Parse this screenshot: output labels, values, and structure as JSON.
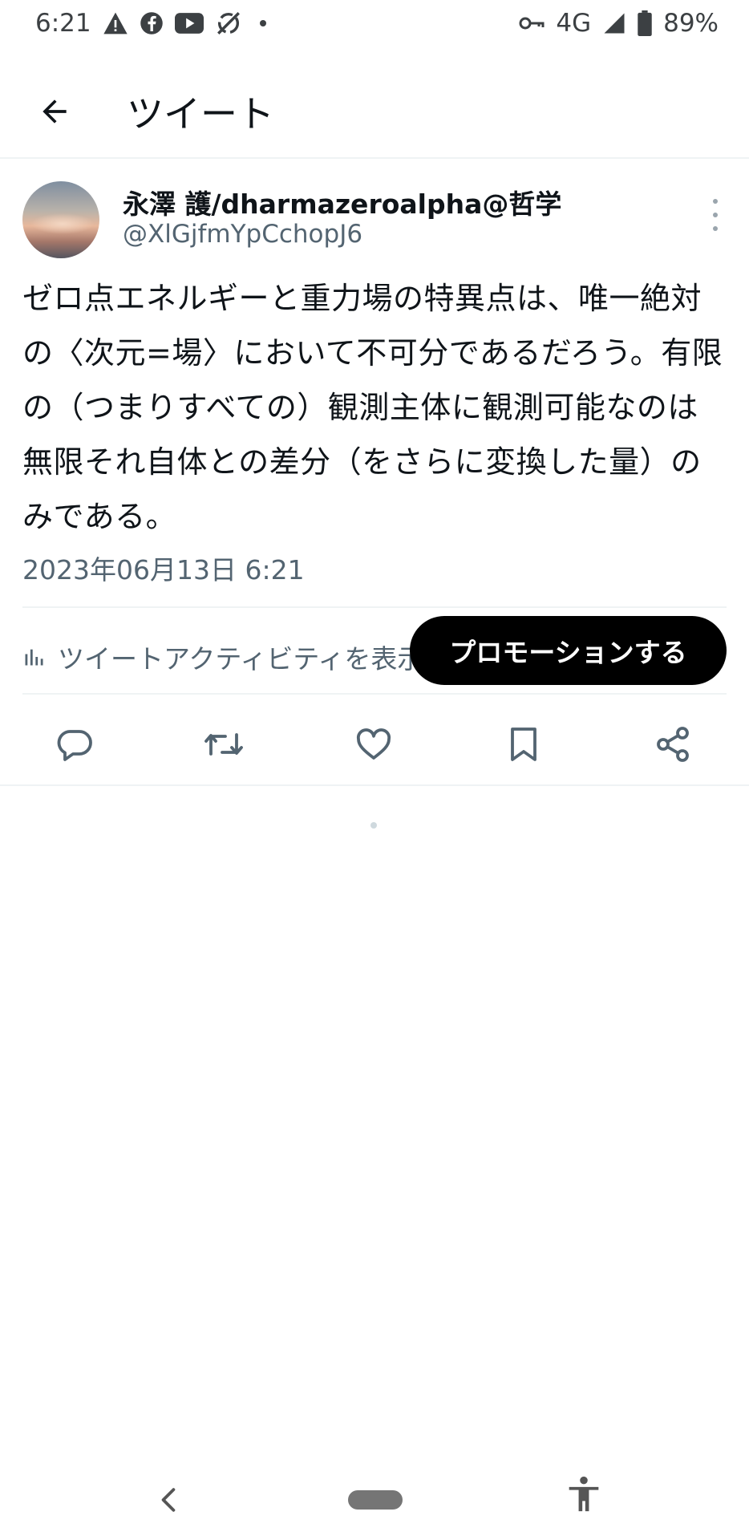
{
  "status_bar": {
    "time": "6:21",
    "network": "4G",
    "battery": "89%",
    "icons": [
      "warning-icon",
      "facebook-icon",
      "youtube-icon",
      "sync-off-icon",
      "vpn-key-icon",
      "signal-icon",
      "battery-icon"
    ]
  },
  "header": {
    "title": "ツイート"
  },
  "tweet": {
    "author_name": "永澤 護/dharmazeroalpha@哲学",
    "author_handle": "@XlGjfmYpCchopJ6",
    "text": "ゼロ点エネルギーと重力場の特異点は、唯一絶対の〈次元=場〉において不可分であるだろう。有限の（つまりすべての）観測主体に観測可能なのは無限それ自体との差分（をさらに変換した量）のみである。",
    "timestamp": "2023年06月13日 6:21",
    "activity_label": "ツイートアクティビティを表示",
    "promote_label": "プロモーションする"
  },
  "actions": [
    "reply-icon",
    "retweet-icon",
    "like-icon",
    "bookmark-icon",
    "share-icon"
  ],
  "colors": {
    "text_primary": "#0f1419",
    "text_secondary": "#536471",
    "divider": "#eff3f4",
    "promote_bg": "#000000"
  }
}
